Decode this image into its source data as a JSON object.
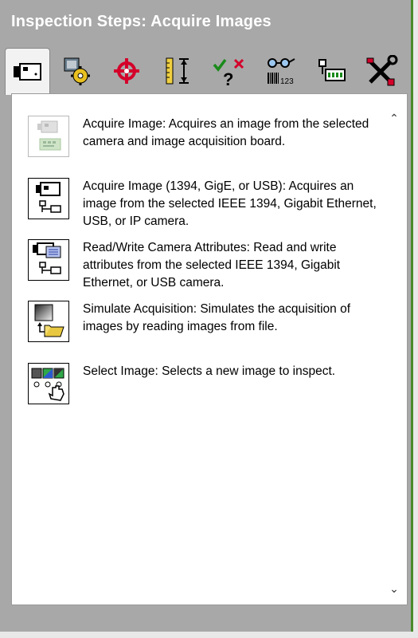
{
  "window": {
    "title": "Inspection Steps: Acquire Images"
  },
  "tabs": [
    {
      "name": "tab-acquire-images",
      "icon": "camera-icon"
    },
    {
      "name": "tab-processing-functions",
      "icon": "gear-image-icon"
    },
    {
      "name": "tab-locate-features",
      "icon": "crosshair-icon"
    },
    {
      "name": "tab-measure-features",
      "icon": "caliper-icon"
    },
    {
      "name": "tab-check-for-presence",
      "icon": "check-question-icon"
    },
    {
      "name": "tab-identify-parts",
      "icon": "barcode-glasses-icon"
    },
    {
      "name": "tab-use-additional-tools",
      "icon": "io-module-icon"
    },
    {
      "name": "tab-machine-vision",
      "icon": "tools-icon"
    }
  ],
  "items": [
    {
      "label": "Acquire Image:  Acquires an image from the selected camera and image acquisition board.",
      "icon": "acquire-board-icon"
    },
    {
      "label": "Acquire Image (1394, GigE, or USB): Acquires an image from the selected IEEE 1394, Gigabit Ethernet, USB, or IP camera.",
      "icon": "acquire-camera-network-icon"
    },
    {
      "label": "Read/Write Camera Attributes:  Read and write attributes from the selected IEEE 1394, Gigabit Ethernet, or USB camera.",
      "icon": "camera-attributes-icon"
    },
    {
      "label": "Simulate Acquisition:  Simulates the acquisition of images by reading images from file.",
      "icon": "folder-image-icon"
    },
    {
      "label": "Select Image:  Selects a new image to inspect.",
      "icon": "select-image-hand-icon"
    }
  ],
  "scroll": {
    "up": "⌃",
    "down": "⌄"
  }
}
